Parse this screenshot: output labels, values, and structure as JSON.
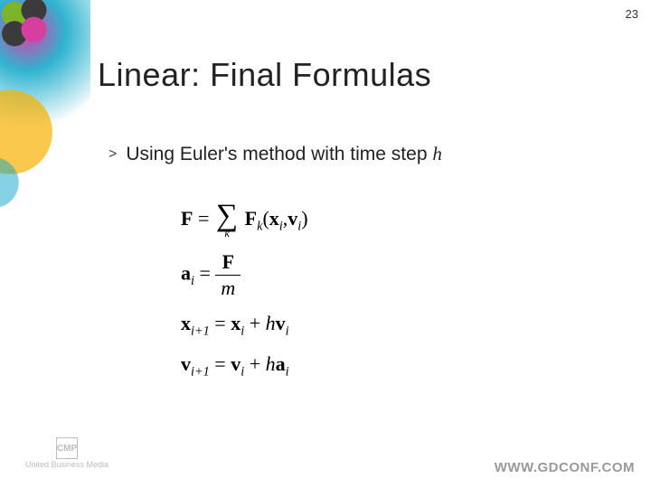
{
  "pageNumber": "23",
  "title": "Linear: Final Formulas",
  "bullet": {
    "glyph": ">",
    "textPrefix": "Using Euler's method with time step ",
    "variable": "h"
  },
  "formulas": {
    "eq1": {
      "lhs": "F",
      "operator": "=",
      "sumIndex": "k",
      "rhsFunc": "F",
      "rhsFuncSub": "k",
      "arg1": "x",
      "arg1Sub": "i",
      "sep": ",",
      "arg2": "v",
      "arg2Sub": "i"
    },
    "eq2": {
      "lhs": "a",
      "lhsSub": "i",
      "operator": "=",
      "num": "F",
      "den": "m"
    },
    "eq3": {
      "lhs": "x",
      "lhsSub": "i+1",
      "operator": "=",
      "term1": "x",
      "term1Sub": "i",
      "plus": "+",
      "coef": "h",
      "term2": "v",
      "term2Sub": "i"
    },
    "eq4": {
      "lhs": "v",
      "lhsSub": "i+1",
      "operator": "=",
      "term1": "v",
      "term1Sub": "i",
      "plus": "+",
      "coef": "h",
      "term2": "a",
      "term2Sub": "i"
    }
  },
  "footer": {
    "url": "WWW.GDCONF.COM",
    "cmp": "CMP",
    "cmpSub": "United Business Media"
  }
}
